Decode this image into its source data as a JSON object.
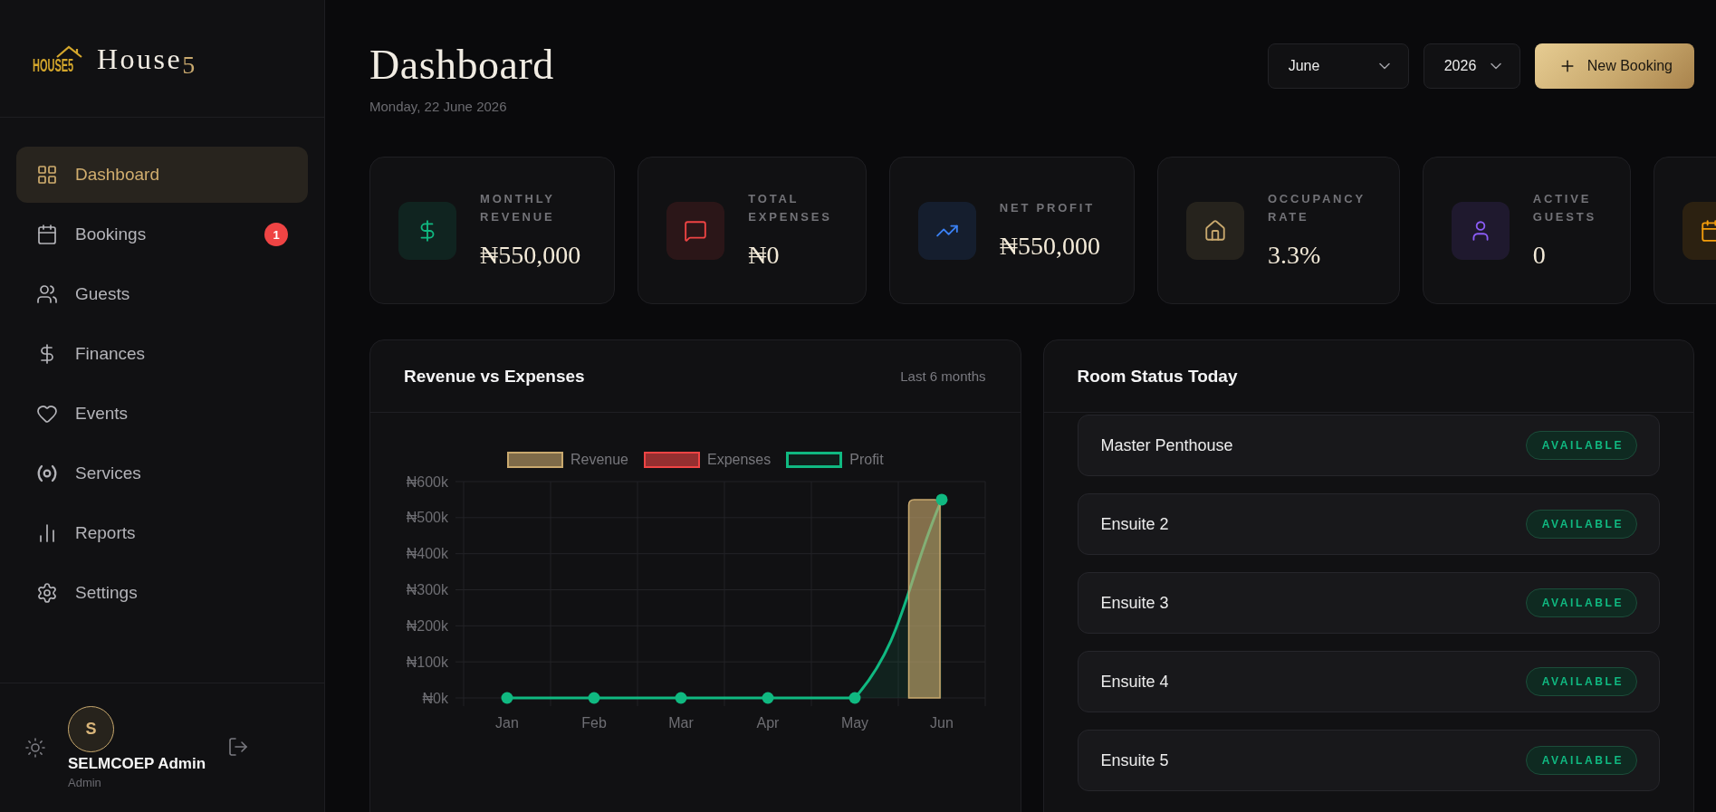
{
  "sidebar": {
    "logo": {
      "mark": "HOUSE5",
      "name": "House",
      "name_accent": "5"
    },
    "nav": [
      {
        "label": "Dashboard",
        "selected": true
      },
      {
        "label": "Bookings",
        "selected": false,
        "badge": "1"
      },
      {
        "label": "Guests",
        "selected": false
      },
      {
        "label": "Finances",
        "selected": false
      },
      {
        "label": "Events",
        "selected": false
      },
      {
        "label": "Services",
        "selected": false
      },
      {
        "label": "Reports",
        "selected": false
      },
      {
        "label": "Settings",
        "selected": false
      }
    ],
    "user": {
      "initial": "S",
      "name": "SELMCOEP Admin",
      "role": "Admin"
    }
  },
  "header": {
    "title": "Dashboard",
    "date": "Monday, 22 June 2026",
    "month": "June",
    "year": "2026",
    "action": "New Booking"
  },
  "stats": [
    {
      "label": "MONTHLY REVENUE",
      "value": "₦550,000",
      "color": "#10b981"
    },
    {
      "label": "TOTAL EXPENSES",
      "value": "₦0",
      "color": "#ef4444"
    },
    {
      "label": "NET PROFIT",
      "value": "₦550,000",
      "color": "#3b82f6"
    },
    {
      "label": "OCCUPANCY RATE",
      "value": "3.3%",
      "color": "#c9a96e"
    },
    {
      "label": "ACTIVE GUESTS",
      "value": "0",
      "color": "#8b5cf6"
    },
    {
      "color": "#f59e0b"
    }
  ],
  "revenue_panel": {
    "title": "Revenue vs Expenses",
    "subtitle": "Last 6 months",
    "chart_data": {
      "type": "bar",
      "grid": true,
      "legend": "top",
      "categories": [
        "Jan",
        "Feb",
        "Mar",
        "Apr",
        "May",
        "Jun"
      ],
      "series": [
        {
          "name": "Revenue",
          "color": "#c9a96e",
          "values": [
            0,
            0,
            0,
            0,
            0,
            550000
          ]
        },
        {
          "name": "Expenses",
          "color": "#ef4444",
          "values": [
            0,
            0,
            0,
            0,
            0,
            0
          ]
        },
        {
          "name": "Profit",
          "type": "area",
          "color": "#10b981",
          "values": [
            0,
            0,
            0,
            0,
            0,
            550000
          ]
        }
      ],
      "ylim": [
        0,
        600000
      ],
      "yticks": [
        {
          "value": 0,
          "label": "₦0k"
        },
        {
          "value": 100000,
          "label": "₦100k"
        },
        {
          "value": 200000,
          "label": "₦200k"
        },
        {
          "value": 300000,
          "label": "₦300k"
        },
        {
          "value": 400000,
          "label": "₦400k"
        },
        {
          "value": 500000,
          "label": "₦500k"
        },
        {
          "value": 600000,
          "label": "₦600k"
        }
      ]
    }
  },
  "room_panel": {
    "title": "Room Status Today",
    "rooms": [
      {
        "name": "Master Penthouse",
        "status": "AVAILABLE"
      },
      {
        "name": "Ensuite 2",
        "status": "AVAILABLE"
      },
      {
        "name": "Ensuite 3",
        "status": "AVAILABLE"
      },
      {
        "name": "Ensuite 4",
        "status": "AVAILABLE"
      },
      {
        "name": "Ensuite 5",
        "status": "AVAILABLE"
      }
    ]
  }
}
